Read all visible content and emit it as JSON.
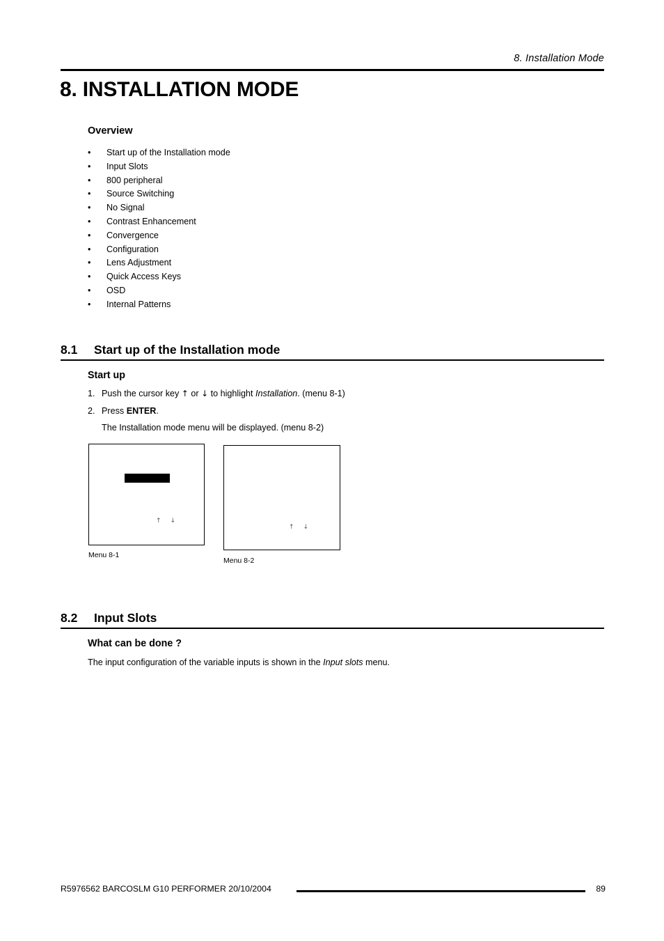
{
  "header": {
    "running_title": "8.  Installation Mode"
  },
  "chapter": {
    "title": "8. INSTALLATION MODE"
  },
  "overview": {
    "heading": "Overview",
    "bullet_char": "•",
    "items": [
      "Start up of the Installation mode",
      "Input Slots",
      "800 peripheral",
      "Source Switching",
      "No Signal",
      "Contrast Enhancement",
      "Convergence",
      "Configuration",
      "Lens Adjustment",
      "Quick Access Keys",
      "OSD",
      "Internal Patterns"
    ]
  },
  "section_81": {
    "number": "8.1",
    "title": "Start up of the Installation mode",
    "sub_heading": "Start up",
    "steps": [
      {
        "marker": "1.",
        "prefix": "Push the cursor key ",
        "arrow_up": "↑",
        "middle": " or ",
        "arrow_down": "↓",
        "suffix_before_italic": " to highlight ",
        "italic": "Installation",
        "suffix": ".  (menu 8-1)"
      },
      {
        "marker": "2.",
        "prefix": "Press ",
        "bold": "ENTER",
        "suffix": "."
      }
    ],
    "result_text": "The Installation mode menu will be displayed.  (menu 8-2)",
    "figures": [
      {
        "caption": "Menu 8-1",
        "arrows": "↑↓"
      },
      {
        "caption": "Menu 8-2",
        "arrows": "↑↓"
      }
    ]
  },
  "section_82": {
    "number": "8.2",
    "title": "Input Slots",
    "sub_heading": "What can be done ?",
    "paragraph": {
      "prefix": "The input configuration of the variable inputs is shown in the ",
      "italic": "Input slots",
      "suffix": " menu."
    }
  },
  "footer": {
    "left": "R5976562  BARCOSLM G10 PERFORMER  20/10/2004",
    "page_number": "89"
  }
}
